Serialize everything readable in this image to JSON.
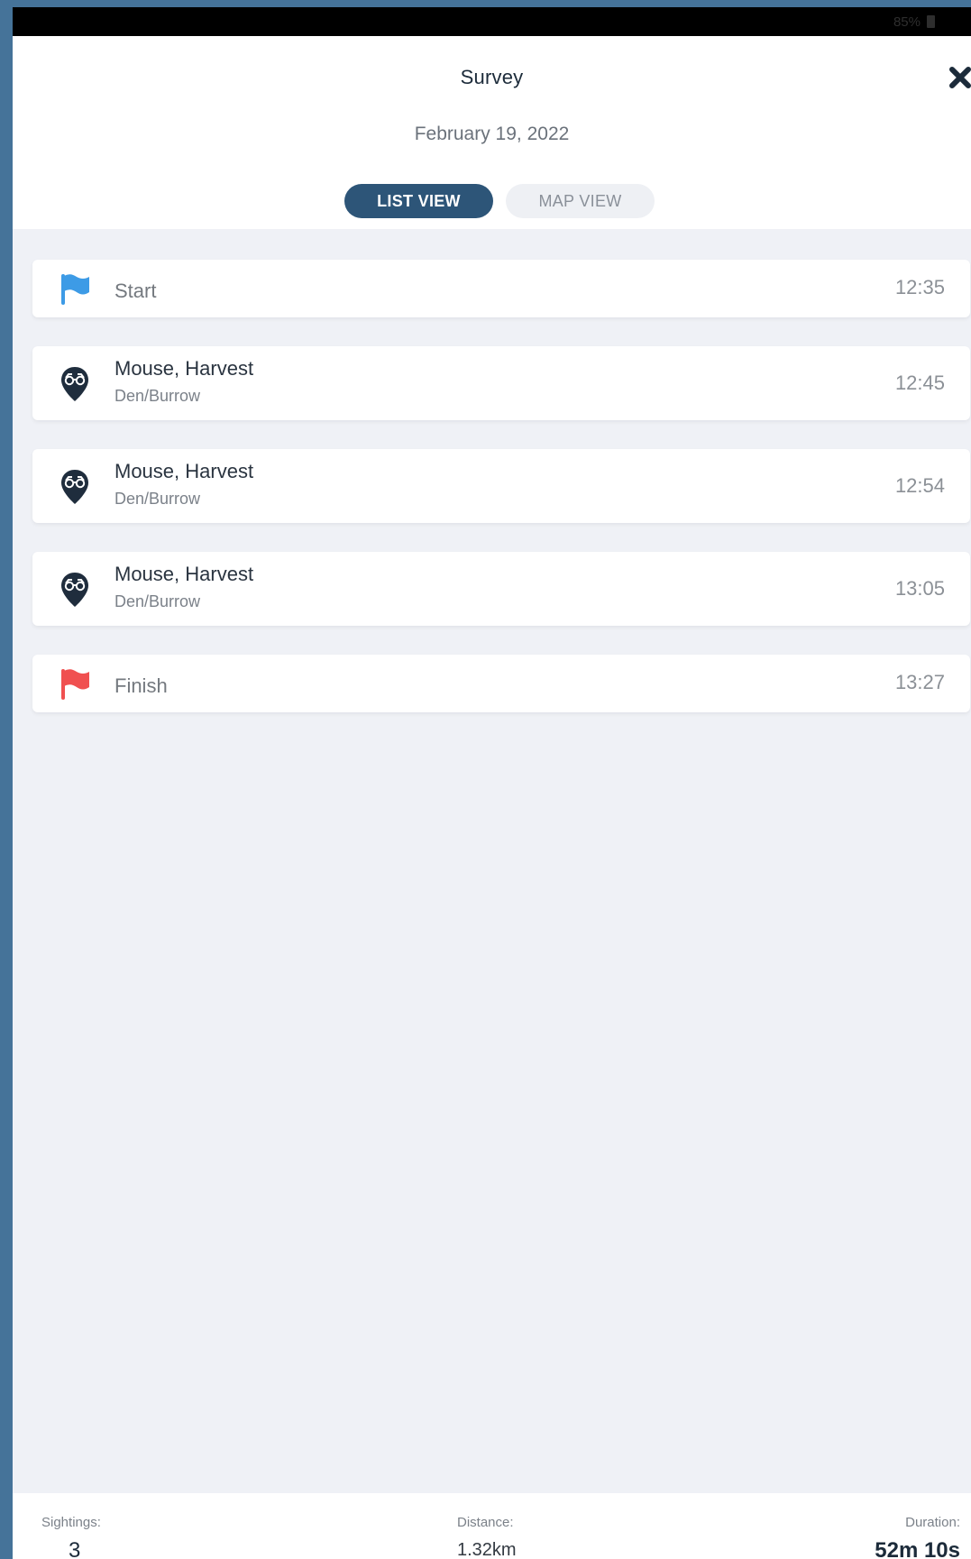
{
  "status_bar": {
    "battery": "85%"
  },
  "header": {
    "title": "Survey",
    "date": "February 19, 2022",
    "close_icon": "close-icon"
  },
  "tabs": [
    {
      "label": "LIST VIEW",
      "active": true
    },
    {
      "label": "MAP VIEW",
      "active": false
    }
  ],
  "entries": [
    {
      "type": "start",
      "label": "Start",
      "time": "12:35",
      "icon": "flag-icon",
      "color": "#3d9be6"
    },
    {
      "type": "sighting",
      "name": "Mouse, Harvest",
      "detail": "Den/Burrow",
      "time": "12:45",
      "icon": "binoculars-pin-icon"
    },
    {
      "type": "sighting",
      "name": "Mouse, Harvest",
      "detail": "Den/Burrow",
      "time": "12:54",
      "icon": "binoculars-pin-icon"
    },
    {
      "type": "sighting",
      "name": "Mouse, Harvest",
      "detail": "Den/Burrow",
      "time": "13:05",
      "icon": "binoculars-pin-icon"
    },
    {
      "type": "finish",
      "label": "Finish",
      "time": "13:27",
      "icon": "flag-icon",
      "color": "#f05050"
    }
  ],
  "footer": {
    "sightings_label": "Sightings:",
    "sightings_value": "3",
    "distance_label": "Distance:",
    "distance_value": "1.32km",
    "duration_label": "Duration:",
    "duration_value": "52m 10s"
  },
  "colors": {
    "accent": "#2d5578",
    "background": "#eff1f6",
    "pin": "#1f2d3d"
  }
}
